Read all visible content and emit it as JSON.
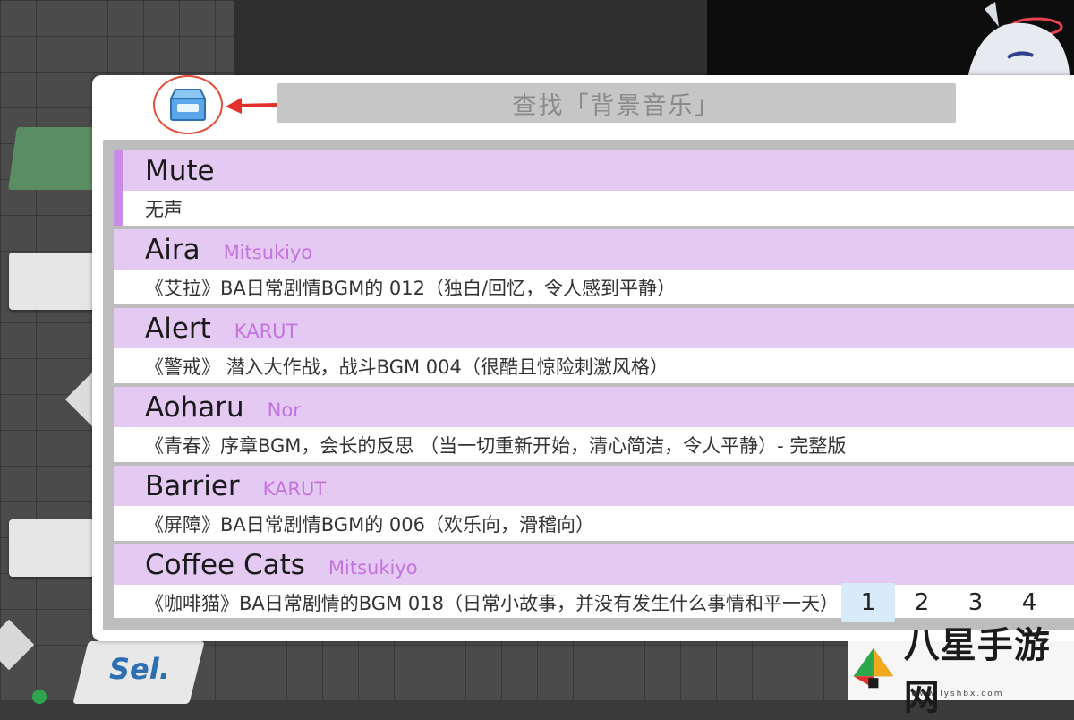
{
  "search": {
    "label": "查找「背景音乐」"
  },
  "tracks": [
    {
      "title": "Mute",
      "artist": "",
      "description": "无声"
    },
    {
      "title": "Aira",
      "artist": "Mitsukiyo",
      "description": "《艾拉》BA日常剧情BGM的 012（独白/回忆，令人感到平静）"
    },
    {
      "title": "Alert",
      "artist": "KARUT",
      "description": "《警戒》 潜入大作战，战斗BGM 004（很酷且惊险刺激风格）"
    },
    {
      "title": "Aoharu",
      "artist": "Nor",
      "description": "《青春》序章BGM，会长的反思 （当一切重新开始，清心简洁，令人平静）- 完整版"
    },
    {
      "title": "Barrier",
      "artist": "KARUT",
      "description": "《屏障》BA日常剧情BGM的 006（欢乐向，滑稽向）"
    },
    {
      "title": "Coffee Cats",
      "artist": "Mitsukiyo",
      "description": "《咖啡猫》BA日常剧情的BGM 018（日常小故事，并没有发生什么事情和平一天）"
    }
  ],
  "pagination": {
    "pages": [
      "1",
      "2",
      "3",
      "4"
    ],
    "current": "1"
  },
  "background": {
    "sel_label": "Sel."
  },
  "watermark": {
    "name": "八星手游网",
    "url": "www.lyshbx.com"
  },
  "colors": {
    "row_header": "#e4c9f2",
    "artist_text": "#c373e0",
    "selected_marker": "#c88ce6",
    "highlight_ring": "#e34c36",
    "search_bar": "#c6c6c6"
  },
  "icons": {
    "bgm_folder": "box-icon",
    "annotation_arrow": "arrow-left-icon"
  }
}
